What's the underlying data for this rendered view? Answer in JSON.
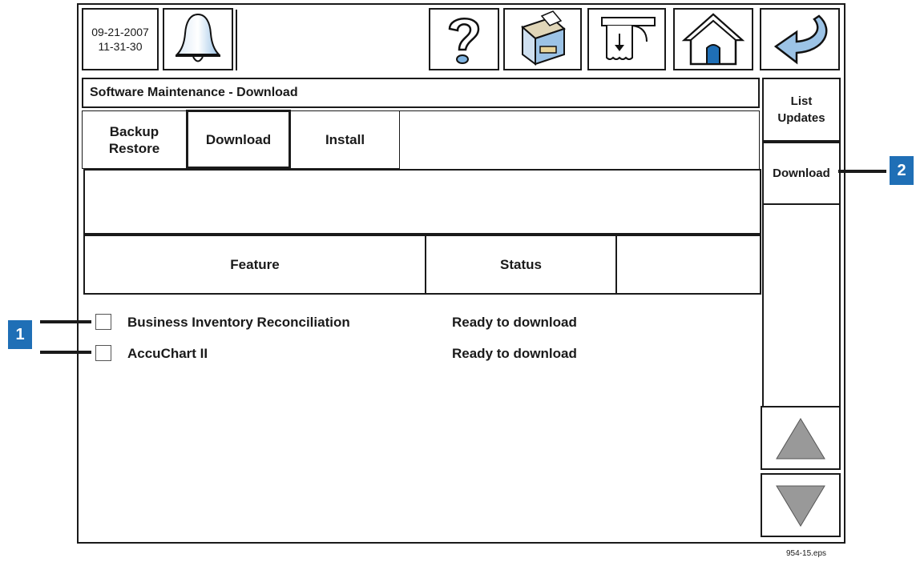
{
  "status": {
    "date": "09-21-2007",
    "time": "11-31-30"
  },
  "toolbar": {
    "icons": [
      "bell-icon",
      "help-icon",
      "printer-icon",
      "receipt-icon",
      "home-icon",
      "back-icon"
    ],
    "accent_color": "#7fb3e0"
  },
  "page_title": "Software Maintenance - Download",
  "tabs": [
    {
      "label": "Backup\nRestore",
      "selected": false
    },
    {
      "label": "Download",
      "selected": true
    },
    {
      "label": "Install",
      "selected": false
    }
  ],
  "table": {
    "headers": [
      "Feature",
      "Status"
    ],
    "rows": [
      {
        "feature": "Business Inventory Reconciliation",
        "status": "Ready to download",
        "checked": false
      },
      {
        "feature": "AccuChart II",
        "status": "Ready to download",
        "checked": false
      }
    ]
  },
  "side_buttons": {
    "list_updates": "List\nUpdates",
    "download": "Download"
  },
  "callouts": {
    "one": "1",
    "two": "2",
    "color": "#1f6fb6"
  },
  "footer_label": "954-15.eps"
}
